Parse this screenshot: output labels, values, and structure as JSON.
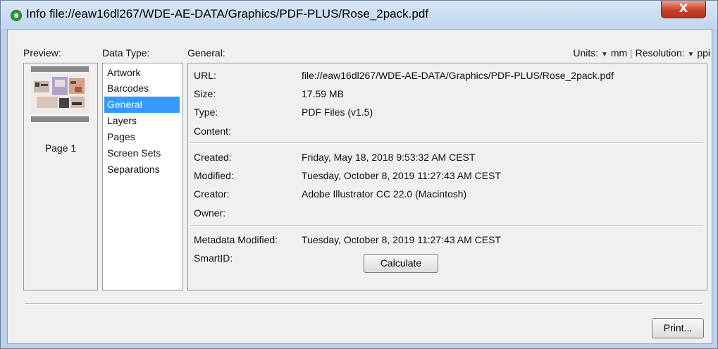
{
  "window": {
    "title": "Info file://eaw16dl267/WDE-AE-DATA/Graphics/PDF-PLUS/Rose_2pack.pdf",
    "close_label": "X"
  },
  "headers": {
    "preview": "Preview:",
    "data_type": "Data Type:",
    "general": "General:",
    "units_label": "Units:",
    "units_value": "mm",
    "resolution_label": "Resolution:",
    "resolution_value": "ppi",
    "separator": "|"
  },
  "preview": {
    "page_label": "Page 1"
  },
  "data_types": {
    "items": [
      "Artwork",
      "Barcodes",
      "General",
      "Layers",
      "Pages",
      "Screen Sets",
      "Separations"
    ],
    "selected": "General"
  },
  "general": {
    "url_label": "URL:",
    "url_value": "file://eaw16dl267/WDE-AE-DATA/Graphics/PDF-PLUS/Rose_2pack.pdf",
    "size_label": "Size:",
    "size_value": "17.59 MB",
    "type_label": "Type:",
    "type_value": "PDF Files (v1.5)",
    "content_label": "Content:",
    "created_label": "Created:",
    "created_value": "Friday, May 18, 2018 9:53:32 AM CEST",
    "modified_label": "Modified:",
    "modified_value": "Tuesday, October 8, 2019 11:27:43 AM CEST",
    "creator_label": "Creator:",
    "creator_value": "Adobe Illustrator CC 22.0 (Macintosh)",
    "owner_label": "Owner:",
    "metadata_modified_label": "Metadata Modified:",
    "metadata_modified_value": "Tuesday, October 8, 2019 11:27:43 AM CEST",
    "smartid_label": "SmartID:",
    "calculate_label": "Calculate"
  },
  "footer": {
    "print_label": "Print..."
  },
  "colors": {
    "selection": "#3399ff",
    "close_button": "#c8432b",
    "title_bar": "#c2d5ee"
  }
}
